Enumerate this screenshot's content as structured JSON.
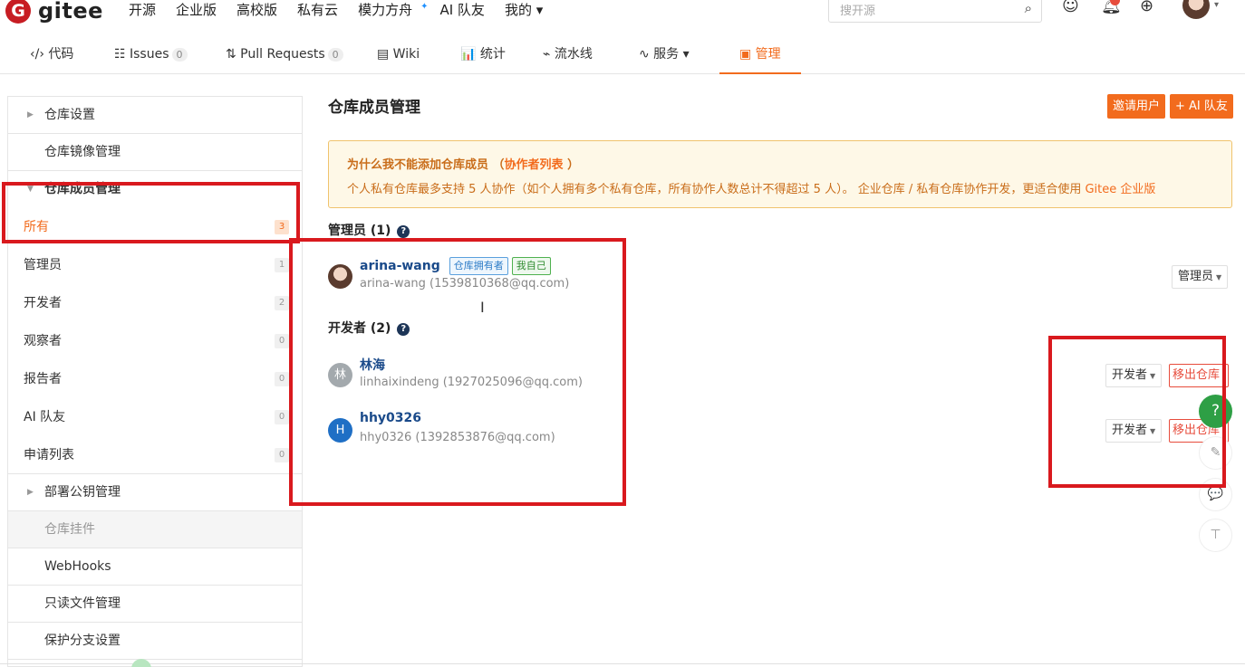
{
  "topnav": {
    "logo_mark": "G",
    "logo_text": "gitee",
    "menu": [
      "开源",
      "企业版",
      "高校版",
      "私有云",
      "模力方舟",
      "AI 队友",
      "我的 ▾"
    ],
    "search_placeholder": "搜开源"
  },
  "tabs": [
    {
      "label": "‹/› 代码"
    },
    {
      "label": "☷ Issues",
      "count": "0"
    },
    {
      "label": "⇅ Pull Requests",
      "count": "0"
    },
    {
      "label": "▤ Wiki"
    },
    {
      "label": "📊 统计"
    },
    {
      "label": "⌁ 流水线"
    },
    {
      "label": "∿ 服务 ▾"
    },
    {
      "label": "▣ 管理"
    }
  ],
  "sidebar": {
    "repo_settings": "仓库设置",
    "mirror_mgmt": "仓库镜像管理",
    "member_mgmt": "仓库成员管理",
    "items": [
      {
        "label": "所有",
        "count": "3"
      },
      {
        "label": "管理员",
        "count": "1"
      },
      {
        "label": "开发者",
        "count": "2"
      },
      {
        "label": "观察者",
        "count": "0"
      },
      {
        "label": "报告者",
        "count": "0"
      },
      {
        "label": "AI 队友",
        "count": "0"
      },
      {
        "label": "申请列表",
        "count": "0"
      }
    ],
    "deploy_keys": "部署公钥管理",
    "plugins": "仓库挂件",
    "webhooks": "WebHooks",
    "readonly_files": "只读文件管理",
    "branch_protect": "保护分支设置"
  },
  "main": {
    "title": "仓库成员管理",
    "invite_btn": "邀请用户",
    "ai_btn": "+ AI 队友",
    "notice": {
      "title": "为什么我不能添加仓库成员 （",
      "title_link": "协作者列表",
      "title_end": " ）",
      "body": "个人私有仓库最多支持 5 人协作（如个人拥有多个私有仓库，所有协作人数总计不得超过 5 人）。 企业仓库 / 私有仓库协作开发，更适合使用 ",
      "body_link": "Gitee 企业版"
    },
    "admin_section": "管理员 (1)",
    "dev_section": "开发者 (2)",
    "admin": {
      "name": "arina-wang",
      "tag_owner": "仓库拥有者",
      "tag_self": "我自己",
      "sub": "arina-wang (1539810368@qq.com)",
      "role": "管理员"
    },
    "devs": [
      {
        "initial": "林",
        "name": "林海",
        "sub": "linhaixindeng (1927025096@qq.com)",
        "role": "开发者",
        "remove": "移出仓库"
      },
      {
        "initial": "H",
        "name": "hhy0326",
        "sub": "hhy0326 (1392853876@qq.com)",
        "role": "开发者",
        "remove": "移出仓库"
      }
    ]
  },
  "floating": {
    "help": "?",
    "edit": "✎",
    "chat": "💬",
    "top": "⊤"
  }
}
